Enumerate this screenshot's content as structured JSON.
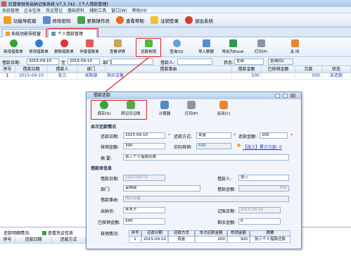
{
  "window": {
    "title": "红管家财务出纳记账系统 V7.3.742 - [个人借款管理]"
  },
  "menu": [
    "系统管理",
    "企业往来",
    "凭证登记",
    "基础资料",
    "辅助工具",
    "窗口(W)",
    "帮助(H)"
  ],
  "topbar": [
    "功能导航窗",
    "修改密码",
    "更换操作员",
    "查看帮助",
    "注销登录",
    "退出系统"
  ],
  "tabs": [
    "系统功能导航窗",
    "个人借款管理"
  ],
  "toolbar": [
    "新增借款单",
    "修改借款单",
    "删除借款单",
    "作废借款单",
    "查看详情",
    "还款核销",
    "查询(Q)",
    "导入数据",
    "导出为Excel",
    "打印(P)",
    "关 闭"
  ],
  "filter": {
    "date_label": "借款日期:",
    "date_from": "2015-09-10",
    "to": "至",
    "date_to": "2015-09-10",
    "dept_label": "部门:",
    "person_label": "借款人:",
    "status_label": "状态:",
    "status": "全部",
    "query": "查询(Q)"
  },
  "grid": {
    "columns": [
      "序号",
      "借款日期",
      "借款人",
      "部门",
      "借款事由",
      "借款金额",
      "已核销金额",
      "欠款",
      "状态"
    ],
    "rows": [
      [
        "1",
        "2015-09-10",
        "张三",
        "采购部",
        "购买设备",
        "500",
        "",
        "500",
        "未还款"
      ]
    ]
  },
  "bottom": {
    "label": "还款明细情况:",
    "link": "查看凭证信息",
    "columns": [
      "序号",
      "还款日期",
      "还款方式"
    ]
  },
  "dialog": {
    "title": "借款还款",
    "buttons": [
      "保存(S)",
      "转记日记账",
      "计算器",
      "打印(P)",
      "关闭(C)"
    ],
    "section1": "本次还款情况",
    "repay_date_label": "还款日期:",
    "repay_date": "2015-09-10",
    "repay_method_label": "还款方式:",
    "repay_method": "现金",
    "repay_amount_label": "还款金额:",
    "repay_amount": "200",
    "writeoff_label": "核销金额:",
    "writeoff": "300",
    "actual_label": "实际核销:",
    "actual": "500",
    "info_link": "【张三】累计欠款: 0",
    "summary_label": "摘    要:",
    "summary": "张三个人借款还款",
    "section2": "借款单信息",
    "loan_date_label": "借款日期:",
    "loan_date": "2015-09-10",
    "borrower_label": "借款人:",
    "borrower": "张三",
    "dept_label": "部门:",
    "dept": "采购部",
    "amount_label": "借款金额:",
    "amount": "500",
    "reason_label": "借款事由:",
    "reason": "购买设备",
    "cashier_label": "出纳员:",
    "cashier": "李木子",
    "record_label": "记账日期:",
    "record_date": "2015-09-10",
    "written_label": "已核销金额:",
    "written": "500",
    "remain_label": "剩余金额:",
    "remain": "0",
    "history_label": "核销情况:",
    "history_cols": [
      "序号",
      "还款日期",
      "还款方式",
      "本次还款金额",
      "核销金额",
      "摘要"
    ],
    "history_row": [
      "1",
      "2015-09-10",
      "现金",
      "200",
      "300",
      "张三个人借款还款"
    ]
  },
  "colors": {
    "accent_red": "#e02020",
    "link_blue": "#1530c8"
  }
}
